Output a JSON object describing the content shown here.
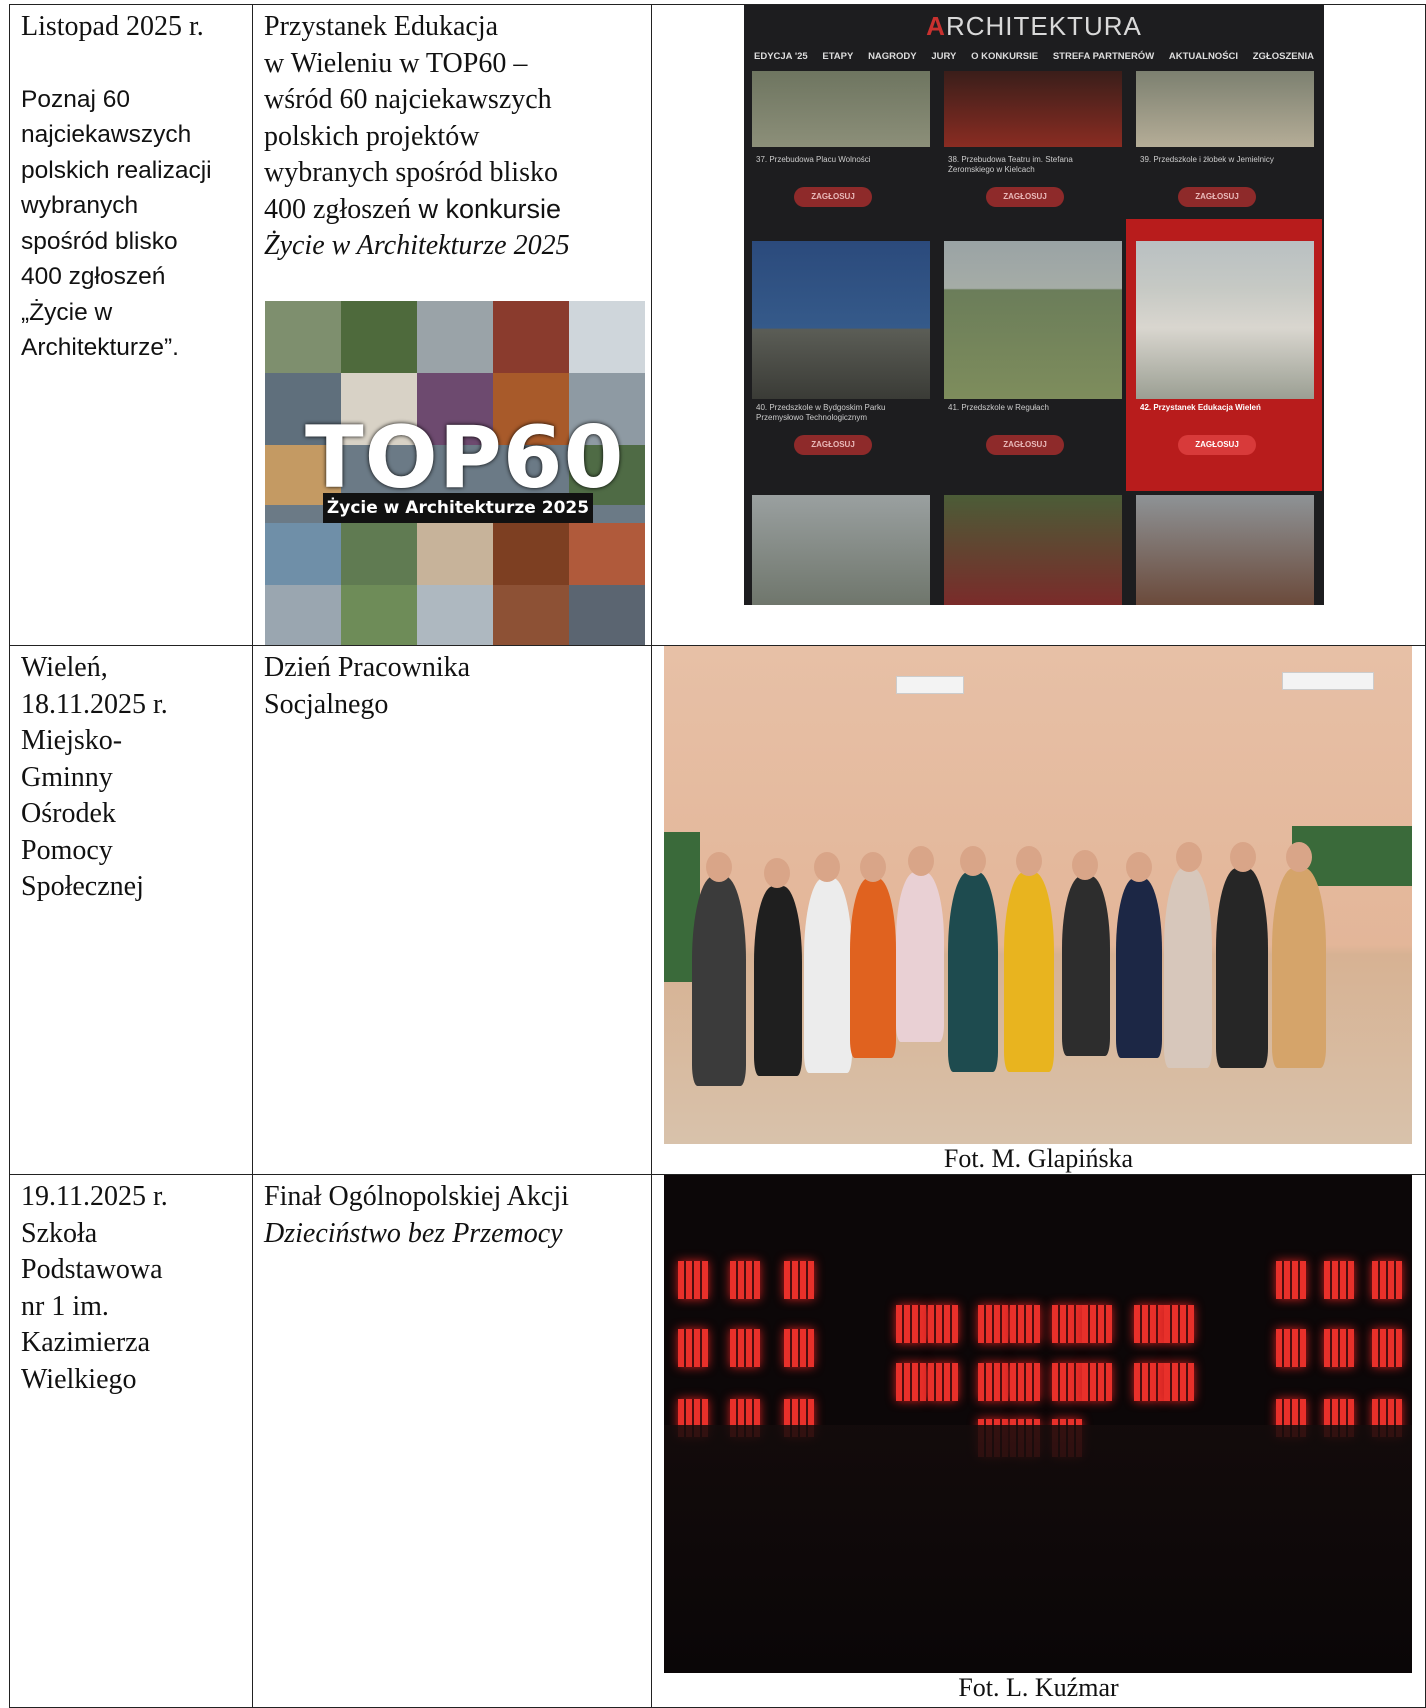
{
  "rows": [
    {
      "date": "Listopad 2025 r.",
      "note_lines": [
        "Poznaj 60",
        "najciekawszych",
        "polskich realizacji",
        "wybranych",
        "spośród blisko",
        "400 zgłoszeń",
        "„Życie w",
        "Architekturze”."
      ],
      "event_lines": [
        "Przystanek Edukacja",
        "w Wieleniu w TOP60 –",
        "wśród 60 najciekawszych",
        "polskich  projektów",
        "wybranych spośród blisko"
      ],
      "event_line_mixed_a": "400 zgłoszeń",
      "event_line_mixed_b": " w konkursie",
      "event_italic": "Życie w Architekturze 2025",
      "collage": {
        "title": "TOP60",
        "subtitle": "Życie w Architekturze 2025"
      },
      "screenshot": {
        "logo_mark": "A",
        "logo_text": "RCHITEKTURA",
        "nav": [
          "EDYCJA '25",
          "ETAPY",
          "NAGRODY",
          "JURY",
          "O KONKURSIE",
          "STREFA PARTNERÓW",
          "AKTUALNOŚCI",
          "ZGŁOSZENIA"
        ],
        "cards": [
          {
            "title": "37.  Przebudowa Placu Wolności",
            "vote": "ZAGŁOSUJ"
          },
          {
            "title": "38.  Przebudowa Teatru im. Stefana Żeromskiego w Kielcach",
            "vote": "ZAGŁOSUJ"
          },
          {
            "title": "39.  Przedszkole i żłobek w Jemielnicy",
            "vote": "ZAGŁOSUJ"
          },
          {
            "title": "40.  Przedszkole w Bydgoskim Parku Przemysłowo Technologicznym",
            "vote": "ZAGŁOSUJ"
          },
          {
            "title": "41.  Przedszkole w Regułach",
            "vote": "ZAGŁOSUJ"
          },
          {
            "title": "42.  Przystanek Edukacja Wieleń",
            "vote": "ZAGŁOSUJ"
          }
        ]
      }
    },
    {
      "date_lines": [
        "Wieleń,",
        "18.11.2025 r.",
        "Miejsko-",
        "Gminny",
        "Ośrodek",
        "Pomocy",
        "Społecznej"
      ],
      "event_lines": [
        "Dzień Pracownika",
        "Socjalnego"
      ],
      "caption": "Fot. M. Glapińska"
    },
    {
      "date_lines": [
        "19.11.2025 r.",
        "Szkoła",
        "Podstawowa",
        "nr 1 im.",
        "Kazimierza",
        "Wielkiego"
      ],
      "event_line": "Finał Ogólnopolskiej Akcji",
      "event_italic": "Dzieciństwo bez Przemocy",
      "caption": "Fot. L. Kuźmar"
    }
  ]
}
